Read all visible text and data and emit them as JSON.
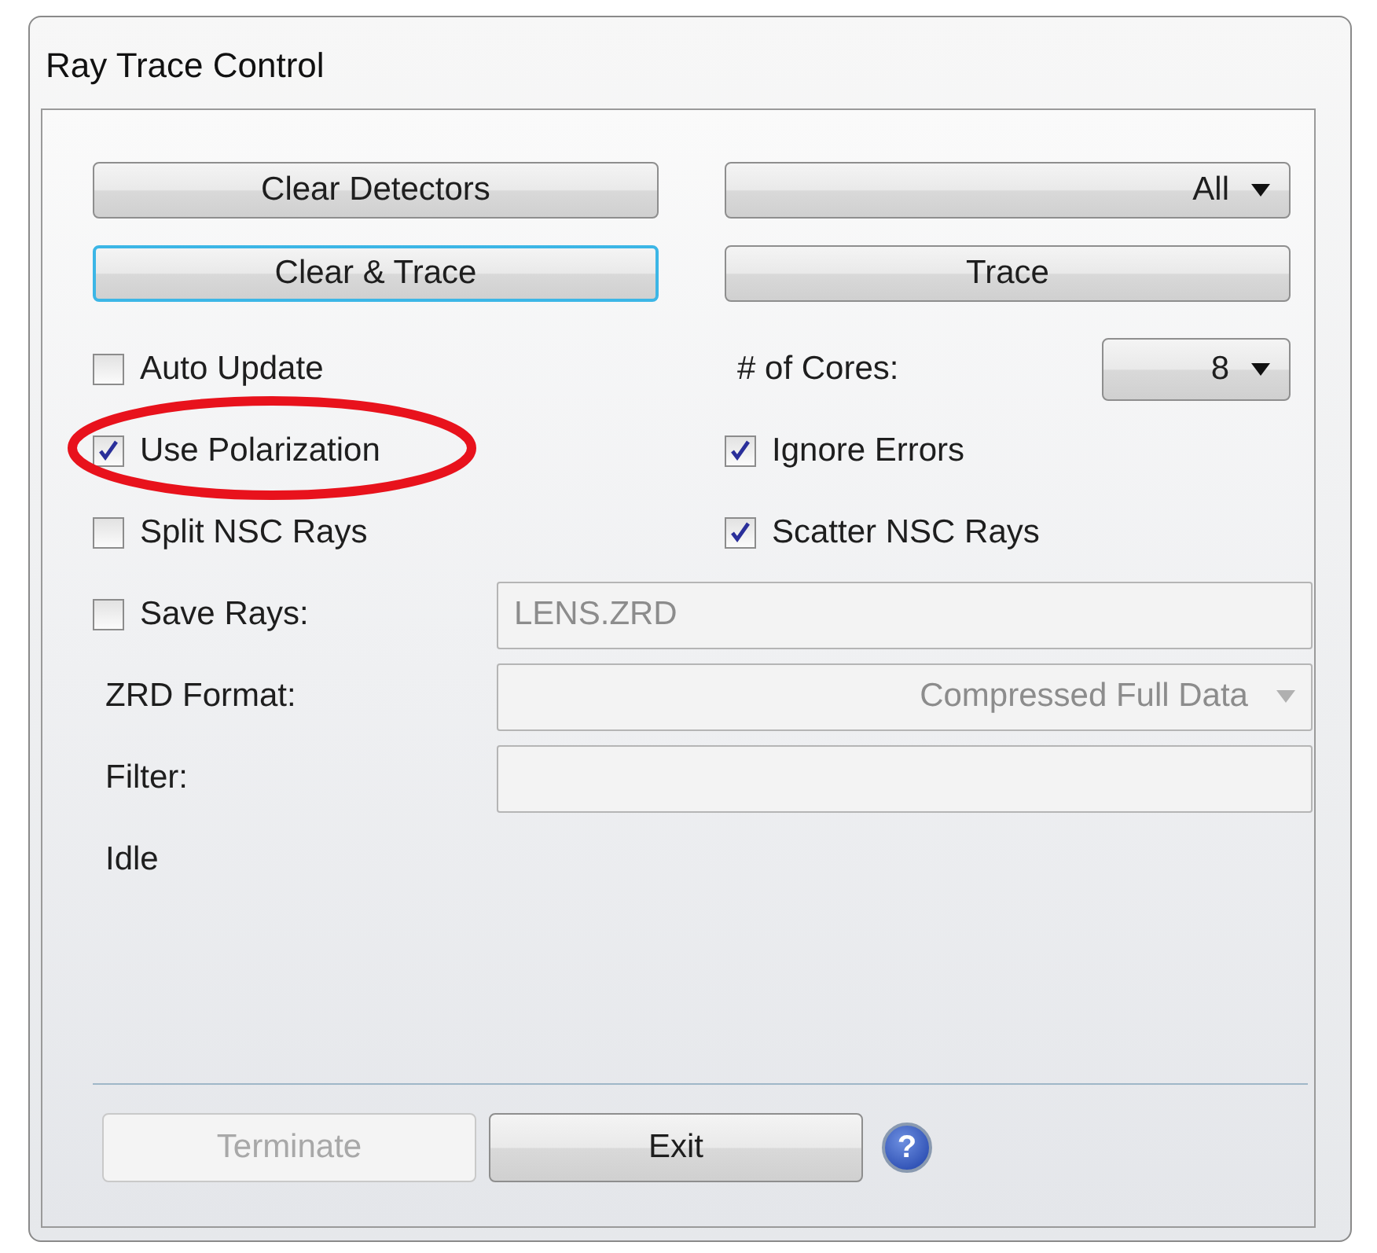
{
  "window": {
    "title": "Ray Trace Control"
  },
  "actions": [
    {
      "kind": "button",
      "label": "Clear Detectors",
      "focused": false
    },
    {
      "kind": "dropdown",
      "value": "All"
    },
    {
      "kind": "button",
      "label": "Clear & Trace",
      "focused": true
    },
    {
      "kind": "button",
      "label": "Trace",
      "focused": false
    }
  ],
  "options": [
    {
      "kind": "checkbox",
      "label": "Auto Update",
      "checked": false
    },
    {
      "kind": "select",
      "label": "# of Cores:",
      "value": "8"
    },
    {
      "kind": "checkbox",
      "label": "Use Polarization",
      "checked": true
    },
    {
      "kind": "checkbox",
      "label": "Ignore Errors",
      "checked": true
    },
    {
      "kind": "checkbox",
      "label": "Split NSC Rays",
      "checked": false
    },
    {
      "kind": "checkbox",
      "label": "Scatter NSC Rays",
      "checked": true
    }
  ],
  "save_rays": {
    "label": "Save Rays:",
    "checked": false,
    "value": "LENS.ZRD",
    "disabled": true
  },
  "zrd_format": {
    "label": "ZRD Format:",
    "value": "Compressed Full Data",
    "disabled": true
  },
  "filter": {
    "label": "Filter:"
  },
  "status": "Idle",
  "footer_buttons": [
    {
      "label": "Terminate",
      "disabled": true
    },
    {
      "label": "Exit",
      "disabled": false
    }
  ],
  "help_button": {
    "label": "?"
  }
}
